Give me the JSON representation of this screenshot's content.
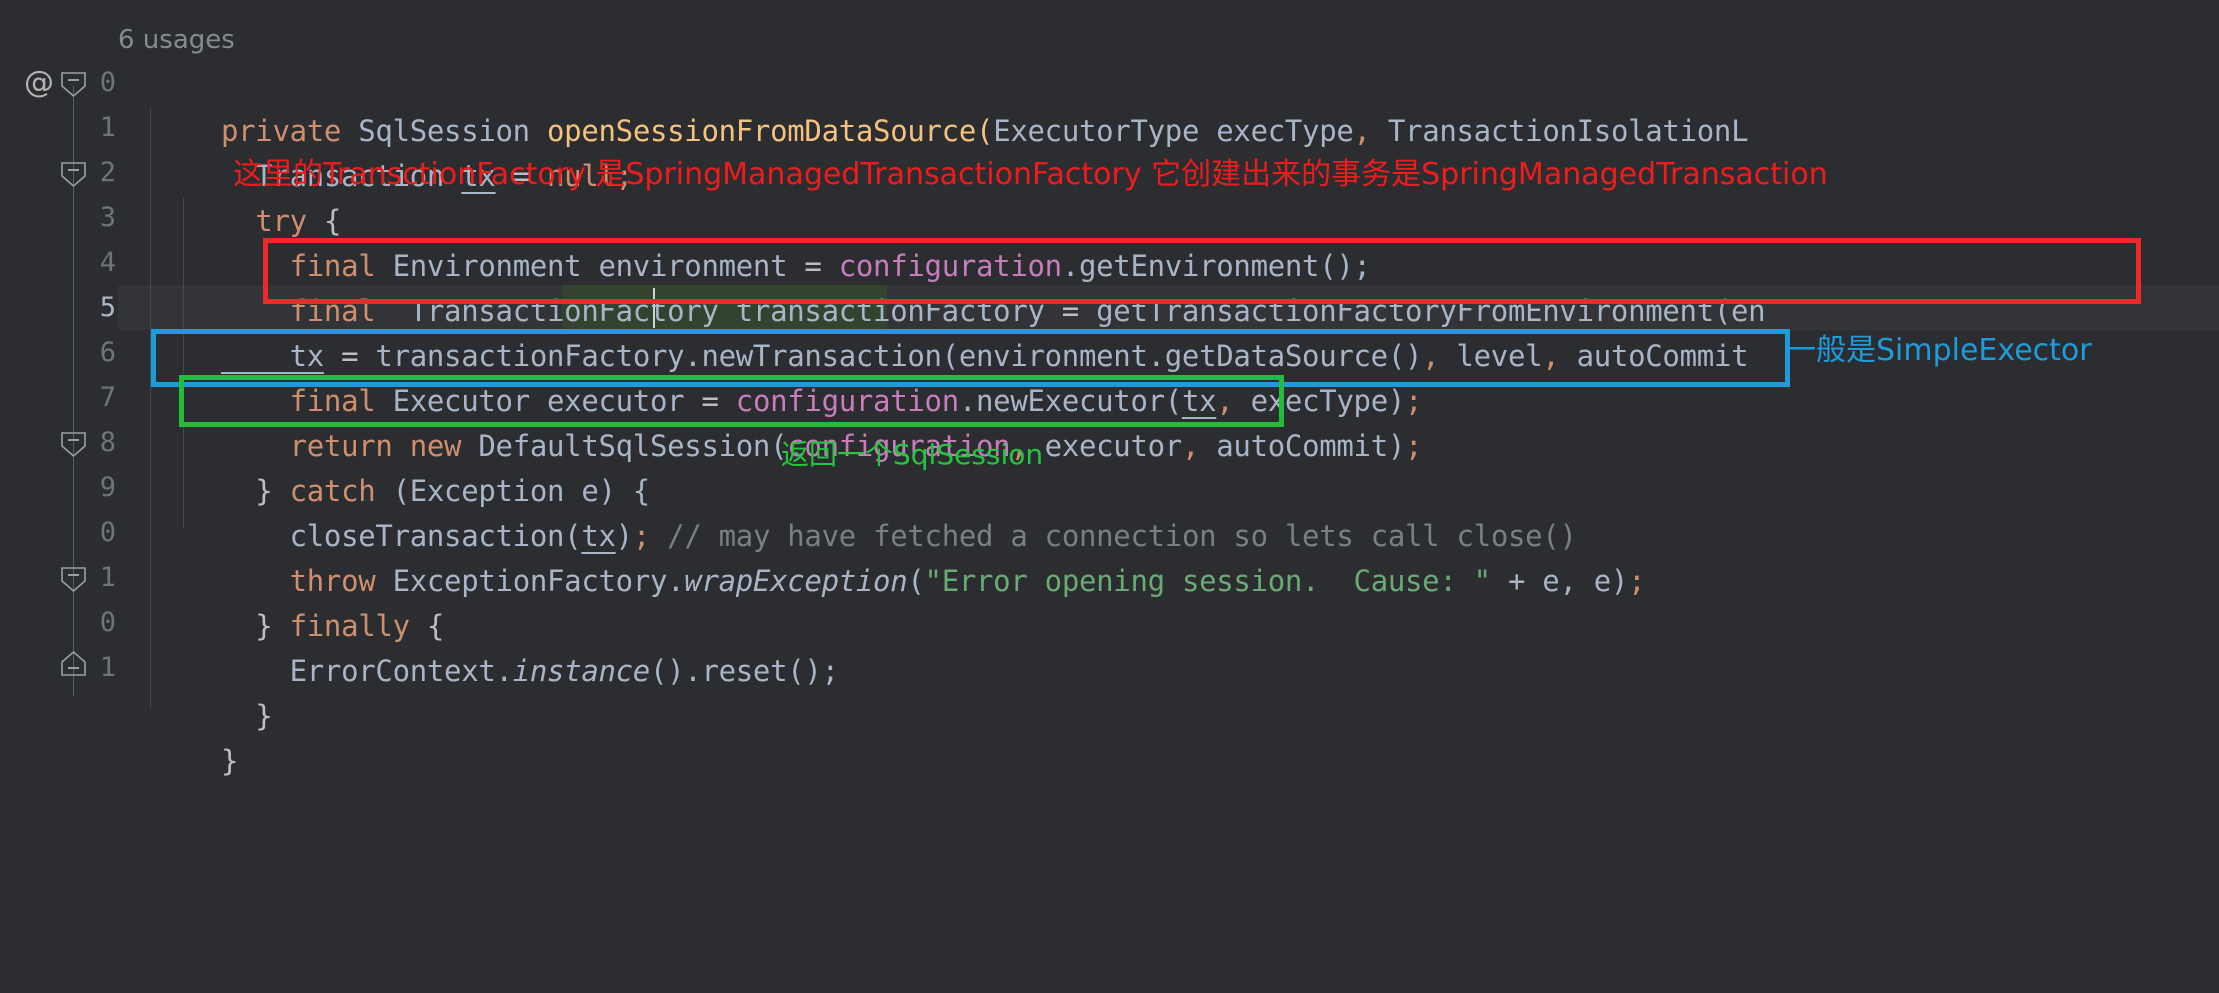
{
  "editor": {
    "app": "intellij-code-editor",
    "language": "java",
    "theme_background": "#2b2d30",
    "usages_label": "6 usages",
    "annotation_at_symbol": "@",
    "line_numbers": [
      "0",
      "1",
      "2",
      "3",
      "4",
      "5",
      "6",
      "7",
      "8",
      "9",
      "0",
      "1"
    ],
    "current_line_number": "5",
    "lines": [
      {
        "n": 0,
        "tokens": [
          {
            "t": "private ",
            "c": "kw"
          },
          {
            "t": "SqlSession ",
            "c": "typ"
          },
          {
            "t": "openSessionFromDataSource",
            "c": "mth"
          },
          {
            "t": "(",
            "c": "plain"
          },
          {
            "t": "ExecutorType execType",
            "c": "typ"
          },
          {
            "t": ",",
            "c": "kw"
          },
          {
            "t": " TransactionIsolationL",
            "c": "typ"
          }
        ]
      },
      {
        "n": 1,
        "tokens": [
          {
            "t": "  Transaction ",
            "c": "typ"
          },
          {
            "t": "tx",
            "c": "typ udl"
          },
          {
            "t": " = ",
            "c": "plain"
          },
          {
            "t": "null;",
            "c": "kw"
          }
        ]
      },
      {
        "n": 2,
        "tokens": [
          {
            "t": "  try ",
            "c": "kw"
          },
          {
            "t": "{",
            "c": "plain"
          }
        ]
      },
      {
        "n": 3,
        "tokens": [
          {
            "t": "    final ",
            "c": "kw"
          },
          {
            "t": "Environment environment",
            "c": "typ"
          },
          {
            "t": " = ",
            "c": "plain"
          },
          {
            "t": "configuration",
            "c": "fld"
          },
          {
            "t": ".getEnvironment();",
            "c": "typ"
          }
        ]
      },
      {
        "n": 4,
        "tokens": [
          {
            "t": "    final ",
            "c": "kw"
          },
          {
            "t": " TransactionFactory transactionFactory",
            "c": "typ"
          },
          {
            "t": " = ",
            "c": "plain"
          },
          {
            "t": "getTransactionFactoryFromEnvironment(en",
            "c": "typ"
          }
        ]
      },
      {
        "n": 5,
        "tokens": [
          {
            "t": "    tx",
            "c": "typ udl"
          },
          {
            "t": " = ",
            "c": "plain"
          },
          {
            "t": "transactionFactory.newTransaction(environment.getDataSource()",
            "c": "typ"
          },
          {
            "t": ",",
            "c": "kw"
          },
          {
            "t": " level",
            "c": "typ"
          },
          {
            "t": ",",
            "c": "kw"
          },
          {
            "t": " autoCommit",
            "c": "typ"
          }
        ]
      },
      {
        "n": 6,
        "tokens": [
          {
            "t": "    final ",
            "c": "kw"
          },
          {
            "t": "Executor executor",
            "c": "typ"
          },
          {
            "t": " = ",
            "c": "plain"
          },
          {
            "t": "configuration",
            "c": "fld"
          },
          {
            "t": ".newExecutor(",
            "c": "typ"
          },
          {
            "t": "tx",
            "c": "typ udl"
          },
          {
            "t": ",",
            "c": "kw"
          },
          {
            "t": " execType)",
            "c": "typ"
          },
          {
            "t": ";",
            "c": "kw"
          }
        ]
      },
      {
        "n": 7,
        "tokens": [
          {
            "t": "    return new ",
            "c": "kw"
          },
          {
            "t": "DefaultSqlSession(",
            "c": "typ"
          },
          {
            "t": "configuration",
            "c": "fld"
          },
          {
            "t": ",",
            "c": "kw"
          },
          {
            "t": " executor",
            "c": "typ"
          },
          {
            "t": ",",
            "c": "kw"
          },
          {
            "t": " autoCommit)",
            "c": "typ"
          },
          {
            "t": ";",
            "c": "kw"
          }
        ]
      },
      {
        "n": 8,
        "tokens": [
          {
            "t": "  } ",
            "c": "plain"
          },
          {
            "t": "catch ",
            "c": "kw"
          },
          {
            "t": "(Exception e) {",
            "c": "typ"
          }
        ]
      },
      {
        "n": 9,
        "tokens": [
          {
            "t": "    closeTransaction(",
            "c": "typ"
          },
          {
            "t": "tx",
            "c": "typ udl"
          },
          {
            "t": ")",
            "c": "typ"
          },
          {
            "t": ";",
            "c": "kw"
          },
          {
            "t": " // may have fetched a connection so lets call close()",
            "c": "cmt"
          }
        ]
      },
      {
        "n": 10,
        "tokens": [
          {
            "t": "    throw ",
            "c": "kw"
          },
          {
            "t": "ExceptionFactory.",
            "c": "typ"
          },
          {
            "t": "wrapException",
            "c": "typ ital"
          },
          {
            "t": "(",
            "c": "typ"
          },
          {
            "t": "\"Error opening session.  Cause: \"",
            "c": "str"
          },
          {
            "t": " + e, e)",
            "c": "typ"
          },
          {
            "t": ";",
            "c": "kw"
          }
        ]
      },
      {
        "n": 11,
        "tokens": [
          {
            "t": "  } ",
            "c": "plain"
          },
          {
            "t": "finally ",
            "c": "kw"
          },
          {
            "t": "{",
            "c": "plain"
          }
        ]
      },
      {
        "n": 12,
        "tokens": [
          {
            "t": "    ErrorContext.",
            "c": "typ"
          },
          {
            "t": "instance",
            "c": "typ ital"
          },
          {
            "t": "().reset();",
            "c": "typ"
          }
        ]
      },
      {
        "n": 13,
        "tokens": [
          {
            "t": "  }",
            "c": "plain"
          }
        ]
      },
      {
        "n": 14,
        "tokens": [
          {
            "t": "}",
            "c": "plain"
          }
        ]
      }
    ],
    "try_inline_note": "这里的TransctionFactory 是SpringManagedTransactionFactory 它创建出来的事务是SpringManagedTransaction"
  },
  "annotations": {
    "red_box_label": "transaction-factory-highlight",
    "blue_box_label": "executor-highlight",
    "green_box_label": "return-statement-highlight",
    "blue_note": "一般是SimpleExector",
    "green_note": "返回一个SqlSession",
    "colors": {
      "red": "#ef2929",
      "blue": "#1e9bdb",
      "green": "#23bd3c",
      "red_text": "#ee1c1c",
      "blue_text": "#1e9bdb",
      "green_text": "#25c63e"
    }
  }
}
